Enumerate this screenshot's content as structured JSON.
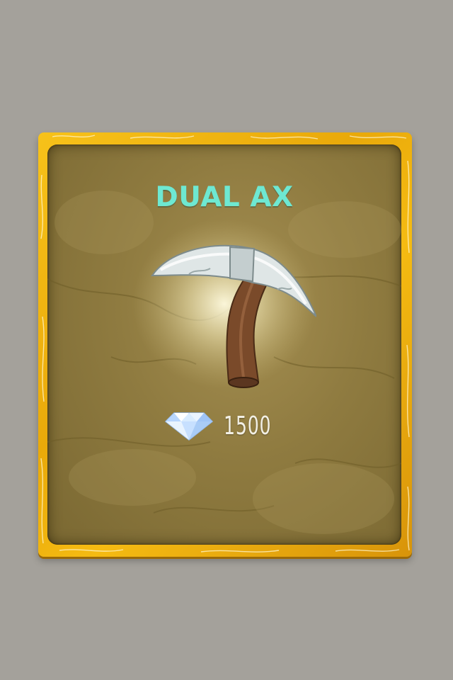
{
  "item": {
    "name": "DUAL AX",
    "icon": "pickaxe-icon",
    "price": "1500",
    "currency_icon": "diamond-icon"
  },
  "colors": {
    "background": "#a4a19b",
    "frame": "#f5bb12",
    "panel": "#8f7b40",
    "title": "#6ee8d2",
    "price_text": "#f2efe4"
  }
}
